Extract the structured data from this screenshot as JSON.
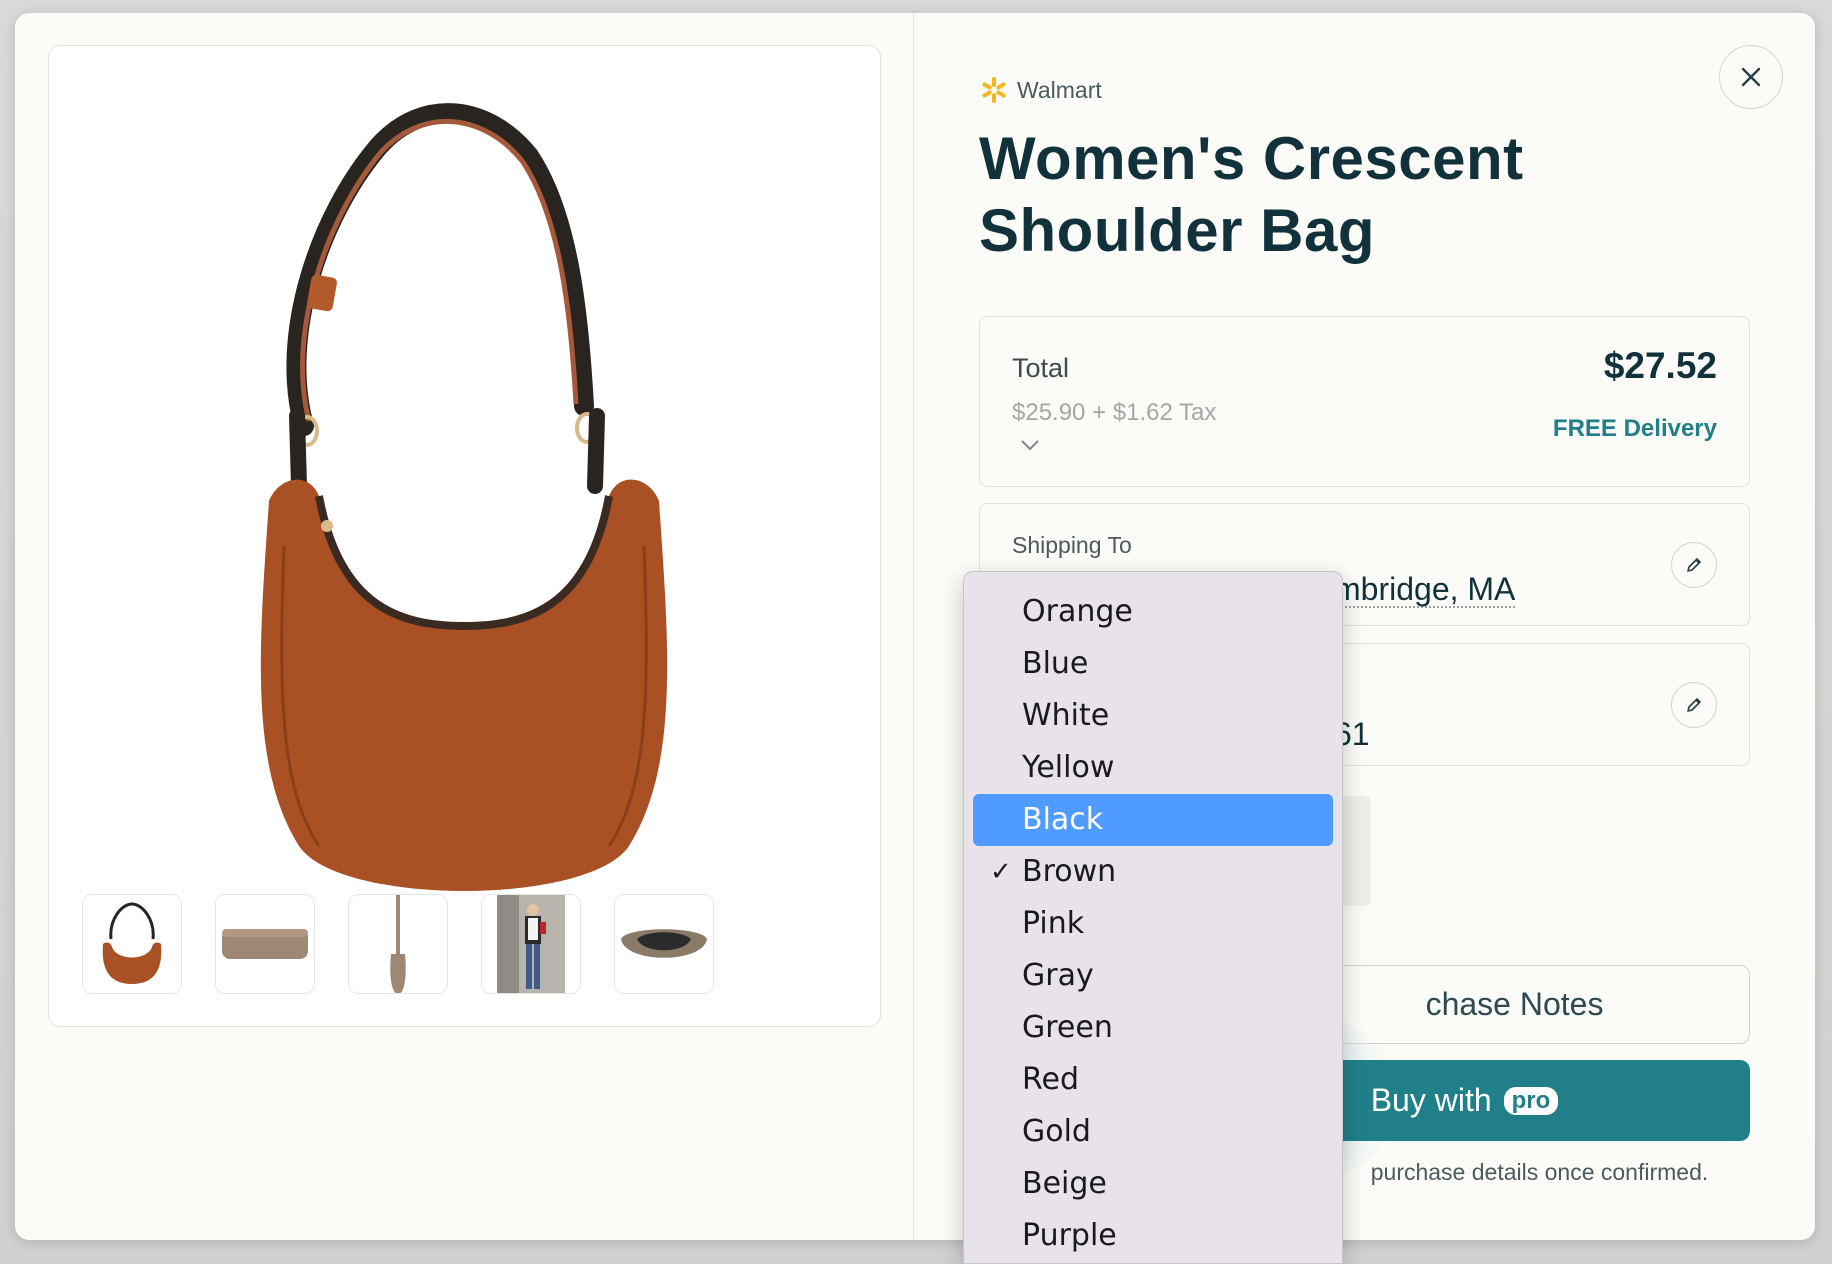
{
  "merchant": {
    "name": "Walmart",
    "logo_color": "#f7b41c"
  },
  "product": {
    "title": "Women's Crescent Shoulder Bag",
    "color_main": "#a95125"
  },
  "gallery": {
    "thumbnails": [
      "thumb-bag-front",
      "thumb-bag-base",
      "thumb-bag-side",
      "thumb-model",
      "thumb-bag-open"
    ]
  },
  "total": {
    "label": "Total",
    "value": "$27.52",
    "breakdown": "$25.90 + $1.62 Tax",
    "delivery": "FREE Delivery"
  },
  "shipping": {
    "label": "Shipping To",
    "value_visible": "mbridge, MA"
  },
  "payment": {
    "value_visible": "61"
  },
  "notes_button": {
    "label_visible": "chase Notes"
  },
  "buy_button": {
    "label": "Buy with",
    "badge": "pro"
  },
  "confirm_text_visible": "purchase details once confirmed.",
  "color_dropdown": {
    "options": [
      "Orange",
      "Blue",
      "White",
      "Yellow",
      "Black",
      "Brown",
      "Pink",
      "Gray",
      "Green",
      "Red",
      "Gold",
      "Beige",
      "Purple"
    ],
    "highlighted": "Black",
    "checked": "Brown",
    "check_mark": "✓"
  },
  "colors": {
    "accent": "#217f89",
    "title": "#12323b",
    "highlight": "#4f9bff"
  }
}
